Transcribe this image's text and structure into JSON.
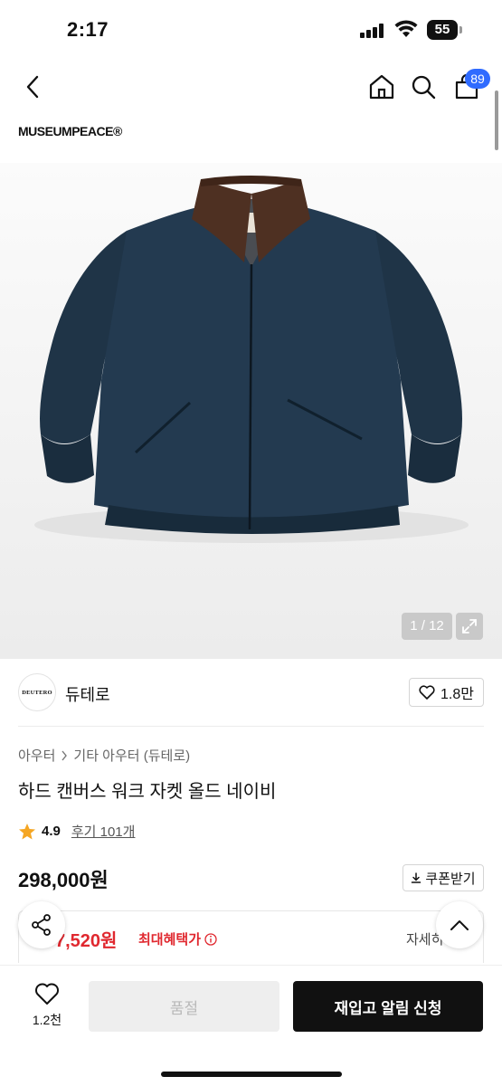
{
  "status_bar": {
    "time": "2:17",
    "battery": "55"
  },
  "header": {
    "cart_count": "89"
  },
  "brand": {
    "logo_text": "MUSEUMPEACE®"
  },
  "gallery": {
    "counter": "1 / 12"
  },
  "store": {
    "logo_text": "DEUTERO",
    "name": "듀테로",
    "likes": "1.8만"
  },
  "breadcrumb": [
    "아우터",
    "기타 아우터 (듀테로)"
  ],
  "product": {
    "title": "하드 캔버스 워크 자켓 올드 네이비",
    "rating": "4.9",
    "reviews": "후기 101개",
    "price": "298,000원",
    "coupon_label": "쿠폰받기"
  },
  "benefit": {
    "price": "7,520원",
    "label": "최대혜택가",
    "detail": "자세히"
  },
  "bottom_bar": {
    "wish_count": "1.2천",
    "soldout_label": "품절",
    "restock_label": "재입고 알림 신청"
  },
  "icons": [
    "back-icon",
    "home-icon",
    "search-icon",
    "cart-icon",
    "expand-icon",
    "heart-icon",
    "star-icon",
    "download-icon",
    "share-icon",
    "chevron-up-icon",
    "info-icon"
  ],
  "colors": {
    "accent_blue": "#2f6bff",
    "benefit_red": "#e0282f",
    "primary_black": "#111111",
    "jacket_navy": "#1f3447",
    "collar_brown": "#4e3022"
  }
}
